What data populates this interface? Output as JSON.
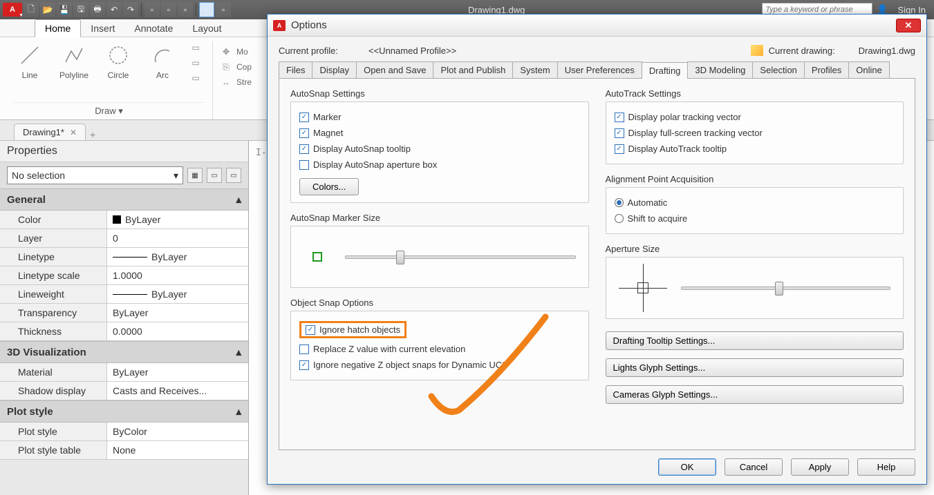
{
  "app": {
    "title": "Drawing1.dwg",
    "signin": "Sign In",
    "search_placeholder": "Type a keyword or phrase"
  },
  "ribbon": {
    "tabs": [
      "Home",
      "Insert",
      "Annotate",
      "Layout"
    ],
    "active_tab": "Home",
    "draw_panel": {
      "title": "Draw ▾",
      "tools": [
        "Line",
        "Polyline",
        "Circle",
        "Arc"
      ],
      "small_tools": [
        "Mo",
        "Cop",
        "Stre"
      ]
    }
  },
  "file_tab": {
    "name": "Drawing1*",
    "plus": "+"
  },
  "properties": {
    "title": "Properties",
    "combo": "No selection",
    "sections": {
      "general": {
        "title": "General",
        "rows": [
          {
            "label": "Color",
            "value": "ByLayer",
            "swatch": true
          },
          {
            "label": "Layer",
            "value": "0"
          },
          {
            "label": "Linetype",
            "value": "ByLayer",
            "line": true
          },
          {
            "label": "Linetype scale",
            "value": "1.0000"
          },
          {
            "label": "Lineweight",
            "value": "ByLayer",
            "line": true
          },
          {
            "label": "Transparency",
            "value": "ByLayer"
          },
          {
            "label": "Thickness",
            "value": "0.0000"
          }
        ]
      },
      "viz3d": {
        "title": "3D Visualization",
        "rows": [
          {
            "label": "Material",
            "value": "ByLayer"
          },
          {
            "label": "Shadow display",
            "value": "Casts and Receives..."
          }
        ]
      },
      "plot": {
        "title": "Plot style",
        "rows": [
          {
            "label": "Plot style",
            "value": "ByColor"
          },
          {
            "label": "Plot style table",
            "value": "None"
          }
        ]
      }
    }
  },
  "canvas": {
    "prompt": "I-"
  },
  "dialog": {
    "title": "Options",
    "profile_label": "Current profile:",
    "profile_value": "<<Unnamed Profile>>",
    "drawing_label": "Current drawing:",
    "drawing_value": "Drawing1.dwg",
    "tabs": [
      "Files",
      "Display",
      "Open and Save",
      "Plot and Publish",
      "System",
      "User Preferences",
      "Drafting",
      "3D Modeling",
      "Selection",
      "Profiles",
      "Online"
    ],
    "active_tab": "Drafting",
    "autosnap": {
      "title": "AutoSnap Settings",
      "items": [
        {
          "label": "Marker",
          "checked": true
        },
        {
          "label": "Magnet",
          "checked": true
        },
        {
          "label": "Display AutoSnap tooltip",
          "checked": true
        },
        {
          "label": "Display AutoSnap aperture box",
          "checked": false
        }
      ],
      "colors_btn": "Colors..."
    },
    "autotrack": {
      "title": "AutoTrack Settings",
      "items": [
        {
          "label": "Display polar tracking vector",
          "checked": true
        },
        {
          "label": "Display full-screen tracking vector",
          "checked": true
        },
        {
          "label": "Display AutoTrack tooltip",
          "checked": true
        }
      ]
    },
    "alignment": {
      "title": "Alignment Point Acquisition",
      "items": [
        {
          "label": "Automatic",
          "checked": true
        },
        {
          "label": "Shift to acquire",
          "checked": false
        }
      ]
    },
    "marker_size_title": "AutoSnap Marker Size",
    "aperture_size_title": "Aperture Size",
    "osnap_options": {
      "title": "Object Snap Options",
      "items": [
        {
          "label": "Ignore hatch objects",
          "checked": true,
          "highlight": true
        },
        {
          "label": "Replace Z value with current elevation",
          "checked": false
        },
        {
          "label": "Ignore negative Z object snaps for Dynamic UCS",
          "checked": true
        }
      ]
    },
    "right_buttons": [
      "Drafting Tooltip Settings...",
      "Lights Glyph Settings...",
      "Cameras Glyph Settings..."
    ],
    "buttons": {
      "ok": "OK",
      "cancel": "Cancel",
      "apply": "Apply",
      "help": "Help"
    }
  }
}
